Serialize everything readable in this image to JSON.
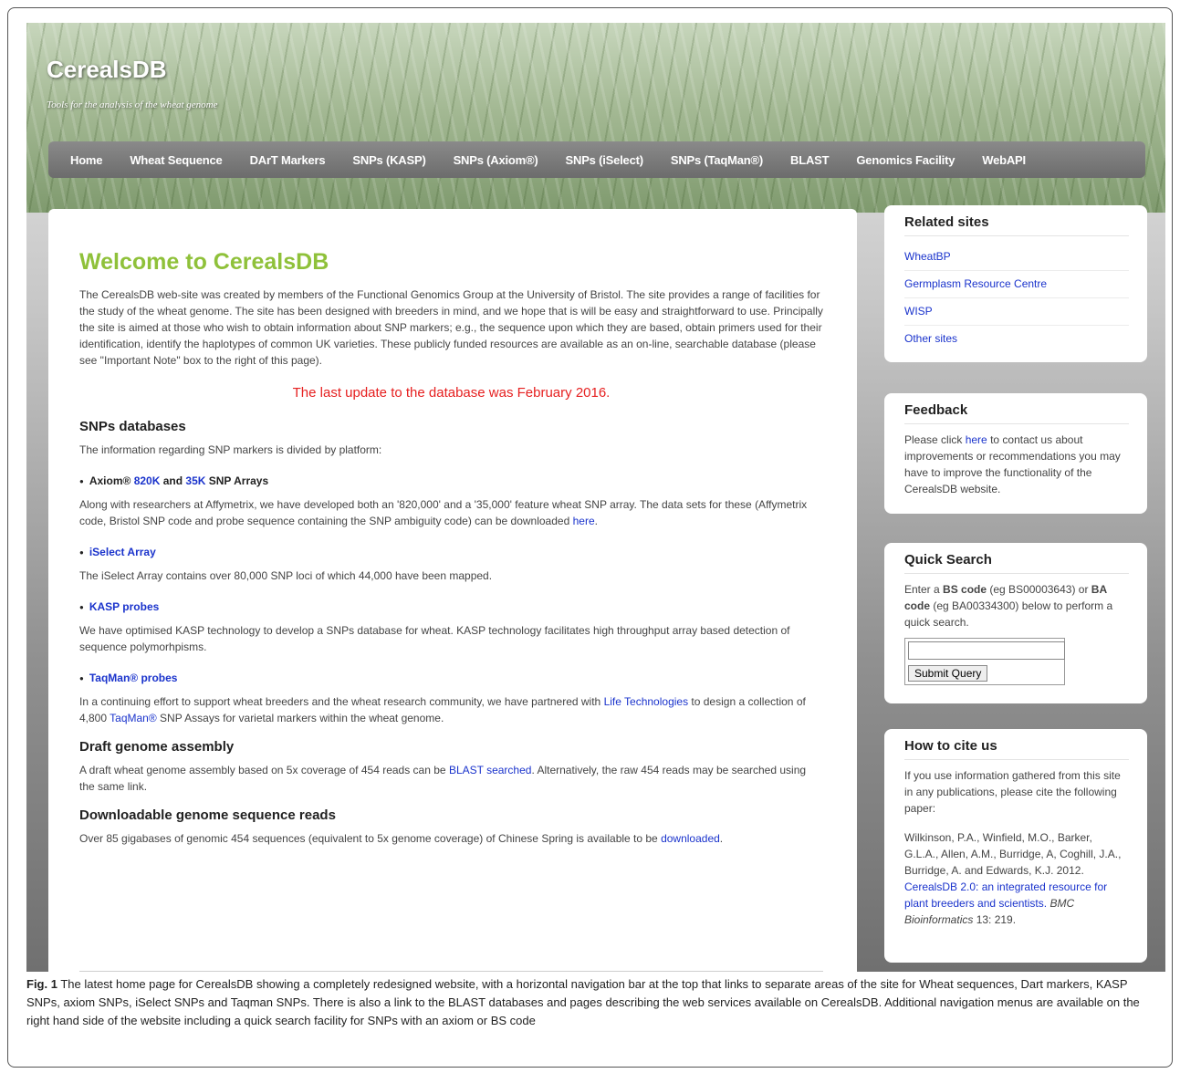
{
  "site": {
    "title": "CerealsDB",
    "tagline": "Tools for the analysis of the wheat genome"
  },
  "nav": {
    "items": [
      "Home",
      "Wheat Sequence",
      "DArT Markers",
      "SNPs (KASP)",
      "SNPs (Axiom®)",
      "SNPs (iSelect)",
      "SNPs (TaqMan®)",
      "BLAST",
      "Genomics Facility",
      "WebAPI"
    ]
  },
  "main": {
    "welcome": "Welcome to CerealsDB",
    "intro": "The CerealsDB web-site was created by members of the Functional Genomics Group at the University of Bristol. The site provides a range of facilities for the study of the wheat genome. The site has been designed with breeders in mind, and we hope that is will be easy and straightforward to use. Principally the site is aimed at those who wish to obtain information about SNP markers; e.g., the sequence upon which they are based, obtain primers used for their identification, identify the haplotypes of common UK varieties. These publicly funded resources are available as an on-line, searchable database (please see \"Important Note\" box to the right of this page).",
    "update": "The last update to the database was February 2016.",
    "snps_heading": "SNPs databases",
    "snps_intro": "The information regarding SNP markers is divided by platform:",
    "axiom": {
      "pre": "Axiom® ",
      "link1": "820K",
      "mid": " and ",
      "link2": "35K",
      "post": " SNP Arrays",
      "desc": "Along with researchers at Affymetrix, we have developed both an '820,000' and a '35,000' feature wheat SNP array. The data sets for these (Affymetrix code, Bristol SNP code and probe sequence containing the SNP ambiguity code) can be downloaded ",
      "desc_link": "here",
      "desc_end": "."
    },
    "iselect": {
      "title": "iSelect Array",
      "desc": "The iSelect Array contains over 80,000 SNP loci of which 44,000 have been mapped."
    },
    "kasp": {
      "title": "KASP probes",
      "desc": "We have optimised KASP technology to develop a SNPs database for wheat. KASP technology facilitates high throughput array based detection of sequence polymorhpisms."
    },
    "taqman": {
      "title": "TaqMan® probes",
      "desc1": "In a continuing effort to support wheat breeders and the wheat research community, we have partnered with ",
      "link1": "Life Technologies",
      "desc2": " to design a collection of 4,800 ",
      "link2": "TaqMan®",
      "desc3": " SNP Assays for varietal markers within the wheat genome."
    },
    "draft": {
      "heading": "Draft genome assembly",
      "desc1": "A draft wheat genome assembly based on 5x coverage of 454 reads can be ",
      "link": "BLAST searched",
      "desc2": ". Alternatively, the raw 454 reads may be searched using the same link."
    },
    "reads": {
      "heading": "Downloadable genome sequence reads",
      "desc1": "Over 85 gigabases of genomic 454 sequences (equivalent to 5x genome coverage) of Chinese Spring is available to be ",
      "link": "downloaded",
      "desc2": "."
    }
  },
  "sidebar": {
    "related": {
      "heading": "Related sites",
      "links": [
        "WheatBP",
        "Germplasm Resource Centre",
        "WISP",
        "Other sites"
      ]
    },
    "feedback": {
      "heading": "Feedback",
      "pre": "Please click ",
      "link": "here",
      "post": " to contact us about improvements or recommendations you may have to improve the functionality of the CerealsDB website."
    },
    "quick_search": {
      "heading": "Quick Search",
      "t1": "Enter a ",
      "b1": "BS code",
      "t2": " (eg BS00003643) or ",
      "b2": "BA code",
      "t3": " (eg BA00334300) below to perform a quick search.",
      "input_value": "",
      "button": "Submit Query"
    },
    "cite": {
      "heading": "How to cite us",
      "intro": "If you use information gathered from this site in any publications, please cite the following paper:",
      "authors": "Wilkinson, P.A., Winfield, M.O., Barker, G.L.A., Allen, A.M., Burridge, A, Coghill, J.A., Burridge, A. and Edwards, K.J. 2012. ",
      "link": "CerealsDB 2.0: an integrated resource for plant breeders and scientists.",
      "journal": "BMC Bioinformatics",
      "vol": " 13: 219."
    }
  },
  "caption": {
    "label": "Fig. 1",
    "text": " The latest home page for CerealsDB showing a completely redesigned website, with a horizontal navigation bar at the top that links to separate areas of the site for Wheat sequences, Dart markers, KASP SNPs, axiom SNPs, iSelect SNPs and Taqman SNPs. There is also a link to the BLAST databases and pages describing the web services available on CerealsDB. Additional navigation menus are available on the right hand side of the website including a quick search facility for SNPs with an axiom or BS code"
  }
}
